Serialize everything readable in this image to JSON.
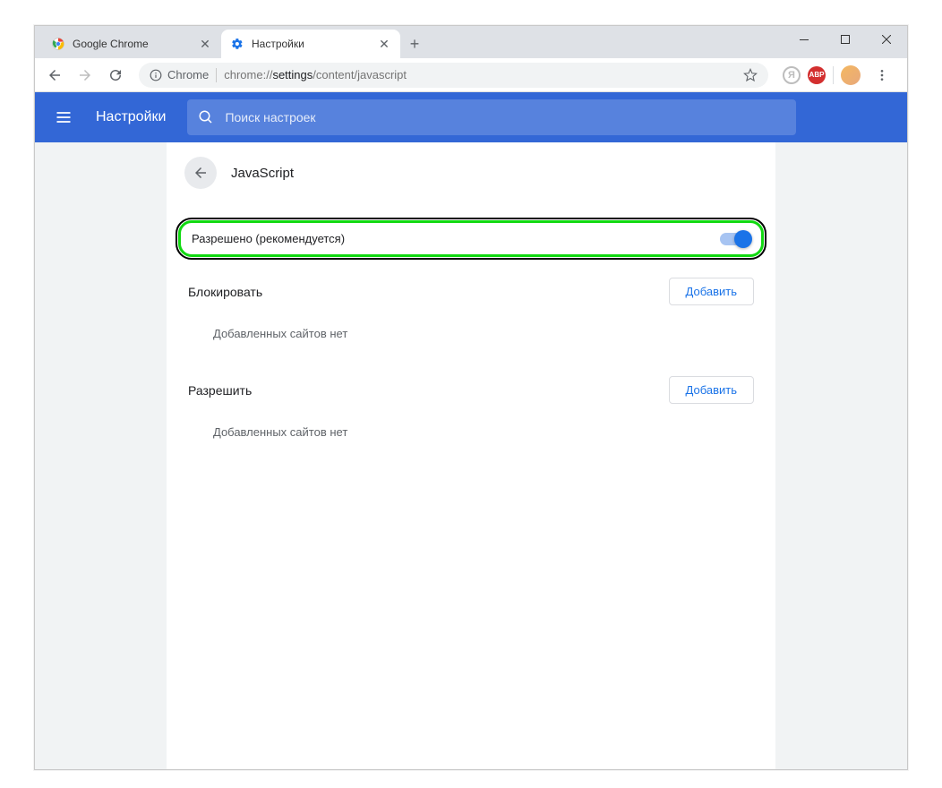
{
  "tabs": [
    {
      "title": "Google Chrome"
    },
    {
      "title": "Настройки"
    }
  ],
  "omnibox": {
    "secure_label": "Chrome",
    "url_prefix": "chrome://",
    "url_bold": "settings",
    "url_suffix": "/content/javascript"
  },
  "header": {
    "title": "Настройки",
    "search_placeholder": "Поиск настроек"
  },
  "panel": {
    "title": "JavaScript",
    "allowed_label": "Разрешено (рекомендуется)"
  },
  "sections": {
    "block": {
      "title": "Блокировать",
      "add_btn": "Добавить",
      "empty": "Добавленных сайтов нет"
    },
    "allow": {
      "title": "Разрешить",
      "add_btn": "Добавить",
      "empty": "Добавленных сайтов нет"
    }
  }
}
